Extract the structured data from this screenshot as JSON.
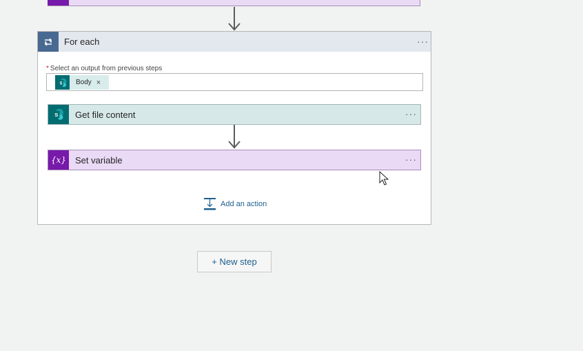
{
  "foreach": {
    "title": "For each",
    "more": "···",
    "required_marker": "*",
    "required_label": "Select an output from previous steps",
    "token": {
      "label": "Body",
      "remove": "×",
      "icon": "sharepoint-icon"
    }
  },
  "actions": [
    {
      "title": "Get file content",
      "more": "···",
      "icon": "sharepoint-icon"
    },
    {
      "title": "Set variable",
      "more": "···",
      "icon": "variable-icon",
      "icon_text": "{x}"
    }
  ],
  "add_action": {
    "label": "Add an action"
  },
  "new_step": {
    "label": "+ New step"
  },
  "colors": {
    "canvas": "#f1f2f2",
    "foreach_accent": "#486991",
    "sharepoint": "#036c70",
    "variable": "#7719aa",
    "link": "#1c5e8e"
  }
}
